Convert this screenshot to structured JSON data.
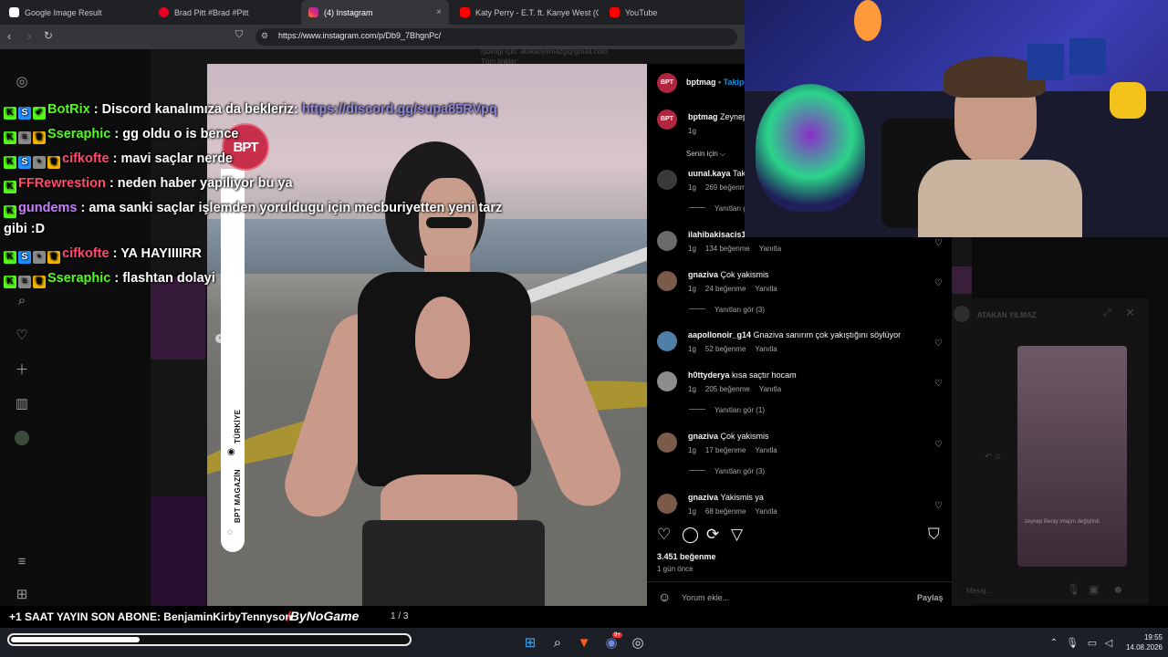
{
  "browser": {
    "tabs": [
      {
        "label": "Google Image Result",
        "icon_color": "#ffffff"
      },
      {
        "label": "Brad Pitt #Brad #Pitt",
        "icon_color": "#e60023"
      },
      {
        "label": "(4) Instagram",
        "icon_color": "#d62976"
      },
      {
        "label": "Katy Perry - E.T. ft. Kanye West (O",
        "icon_color": "#ff0000"
      },
      {
        "label": "YouTube",
        "icon_color": "#ff0000"
      }
    ],
    "active_tab_close": "×",
    "url": "https://www.instagram.com/p/Db9_7BhgnPc/"
  },
  "chat": [
    {
      "user": "BotRix",
      "user_color": "#53fc18",
      "badges": [
        "K",
        "S",
        "✔"
      ],
      "message": " : Discord kanalımıza da bekleriz: ",
      "link": "https://discord.gg/supa85RVpq"
    },
    {
      "user": "Sseraphic",
      "user_color": "#53fc18",
      "badges": [
        "K",
        "≡",
        "♛"
      ],
      "message": " : gg oldu o is bence"
    },
    {
      "user": "cifkofte",
      "user_color": "#ff4b6e",
      "badges": [
        "K",
        "S",
        "•",
        "♛"
      ],
      "message": " : mavi saçlar nerde"
    },
    {
      "user": "FFRewrestion",
      "user_color": "#ff4b6e",
      "badges": [
        "K"
      ],
      "message": " : neden haber yapiliyor bu ya"
    },
    {
      "user": "gundems",
      "user_color": "#c77dff",
      "badges": [
        "K"
      ],
      "message": " : ama sanki saçlar işlemden yoruldugu için mecburiyetten yeni tarz"
    },
    {
      "user": "",
      "user_color": "#ffffff",
      "badges": [],
      "message": "gibi :D"
    },
    {
      "user": "cifkofte",
      "user_color": "#ff4b6e",
      "badges": [
        "K",
        "S",
        "•",
        "♛"
      ],
      "message": " : YA HAYIIIIRR"
    },
    {
      "user": "Sseraphic",
      "user_color": "#53fc18",
      "badges": [
        "K",
        "≡",
        "♛"
      ],
      "message": " : flashtan dolayi"
    }
  ],
  "post": {
    "badge": "BPT",
    "strip_top": "TÜRKİYE",
    "strip_bottom": "BPT MAGAZİN",
    "page_indicator": "1 / 3"
  },
  "panel": {
    "header_user": "bptmag",
    "header_follow": "Takip",
    "caption_user": "bptmag",
    "caption_text": "Zeynep",
    "caption_time": "1g",
    "filter_label": "Senin için",
    "comments": [
      {
        "user": "uunal.kaya",
        "text": "Taki",
        "time": "1g",
        "likes": "269 beğenme",
        "reply": "Yanıtla",
        "more": "Yanıtları g",
        "avatar": "#3a3a3a"
      },
      {
        "user": "ilahibakisacis1",
        "text": "",
        "time": "1g",
        "likes": "134 beğenme",
        "reply": "Yanıtla",
        "more": "",
        "avatar": "#6a6a6a"
      },
      {
        "user": "gnaziva",
        "text": "Çok yakismis",
        "time": "1g",
        "likes": "24 beğenme",
        "reply": "Yanıtla",
        "more": "Yanıtları gör (3)",
        "avatar": "#7a5a48"
      },
      {
        "user": "aapollonoir_g14",
        "text": "Gnaziva sanırım çok yakıştığını söylüyor",
        "time": "1g",
        "likes": "52 beğenme",
        "reply": "Yanıtla",
        "more": "",
        "avatar": "#4f7ea6"
      },
      {
        "user": "h0ttyderya",
        "text": "kısa saçtır hocam",
        "time": "1g",
        "likes": "205 beğenme",
        "reply": "Yanıtla",
        "more": "Yanıtları gör (1)",
        "avatar": "#8c8c8c"
      },
      {
        "user": "gnaziva",
        "text": "Çok yakismis",
        "time": "1g",
        "likes": "17 beğenme",
        "reply": "Yanıtla",
        "more": "Yanıtları gör (3)",
        "avatar": "#7a5a48"
      },
      {
        "user": "gnaziva",
        "text": "Yakismis ya",
        "time": "1g",
        "likes": "68 beğenme",
        "reply": "Yanıtla",
        "more": "",
        "avatar": "#7a5a48"
      }
    ],
    "likes_total": "3.451 beğenme",
    "posted_ago": "1 gün önce",
    "comment_placeholder": "Yorum ekle...",
    "share_label": "Paylaş"
  },
  "background": {
    "top_text_1": "işbirliği için: atakanyilmazg@gmail.com",
    "top_text_2": "Tüm linkler:",
    "dm_user": "ATAKAN YILMAZ",
    "dm_caption": "zeynep Beray imajını değiştirdi.",
    "dm_placeholder": "Mesaj..."
  },
  "stream": {
    "sub_text": "+1 SAAT YAYIN SON ABONE: BenjaminKirbyTennyson",
    "logo_text": "ByNoGame",
    "progress": 0.33
  },
  "taskbar": {
    "time": "19:55",
    "date": "14.08.2026",
    "discord_badge": "9+"
  },
  "icons": {
    "back": "back-icon",
    "forward": "forward-icon",
    "reload": "reload-icon",
    "bookmark": "bookmark-icon"
  }
}
